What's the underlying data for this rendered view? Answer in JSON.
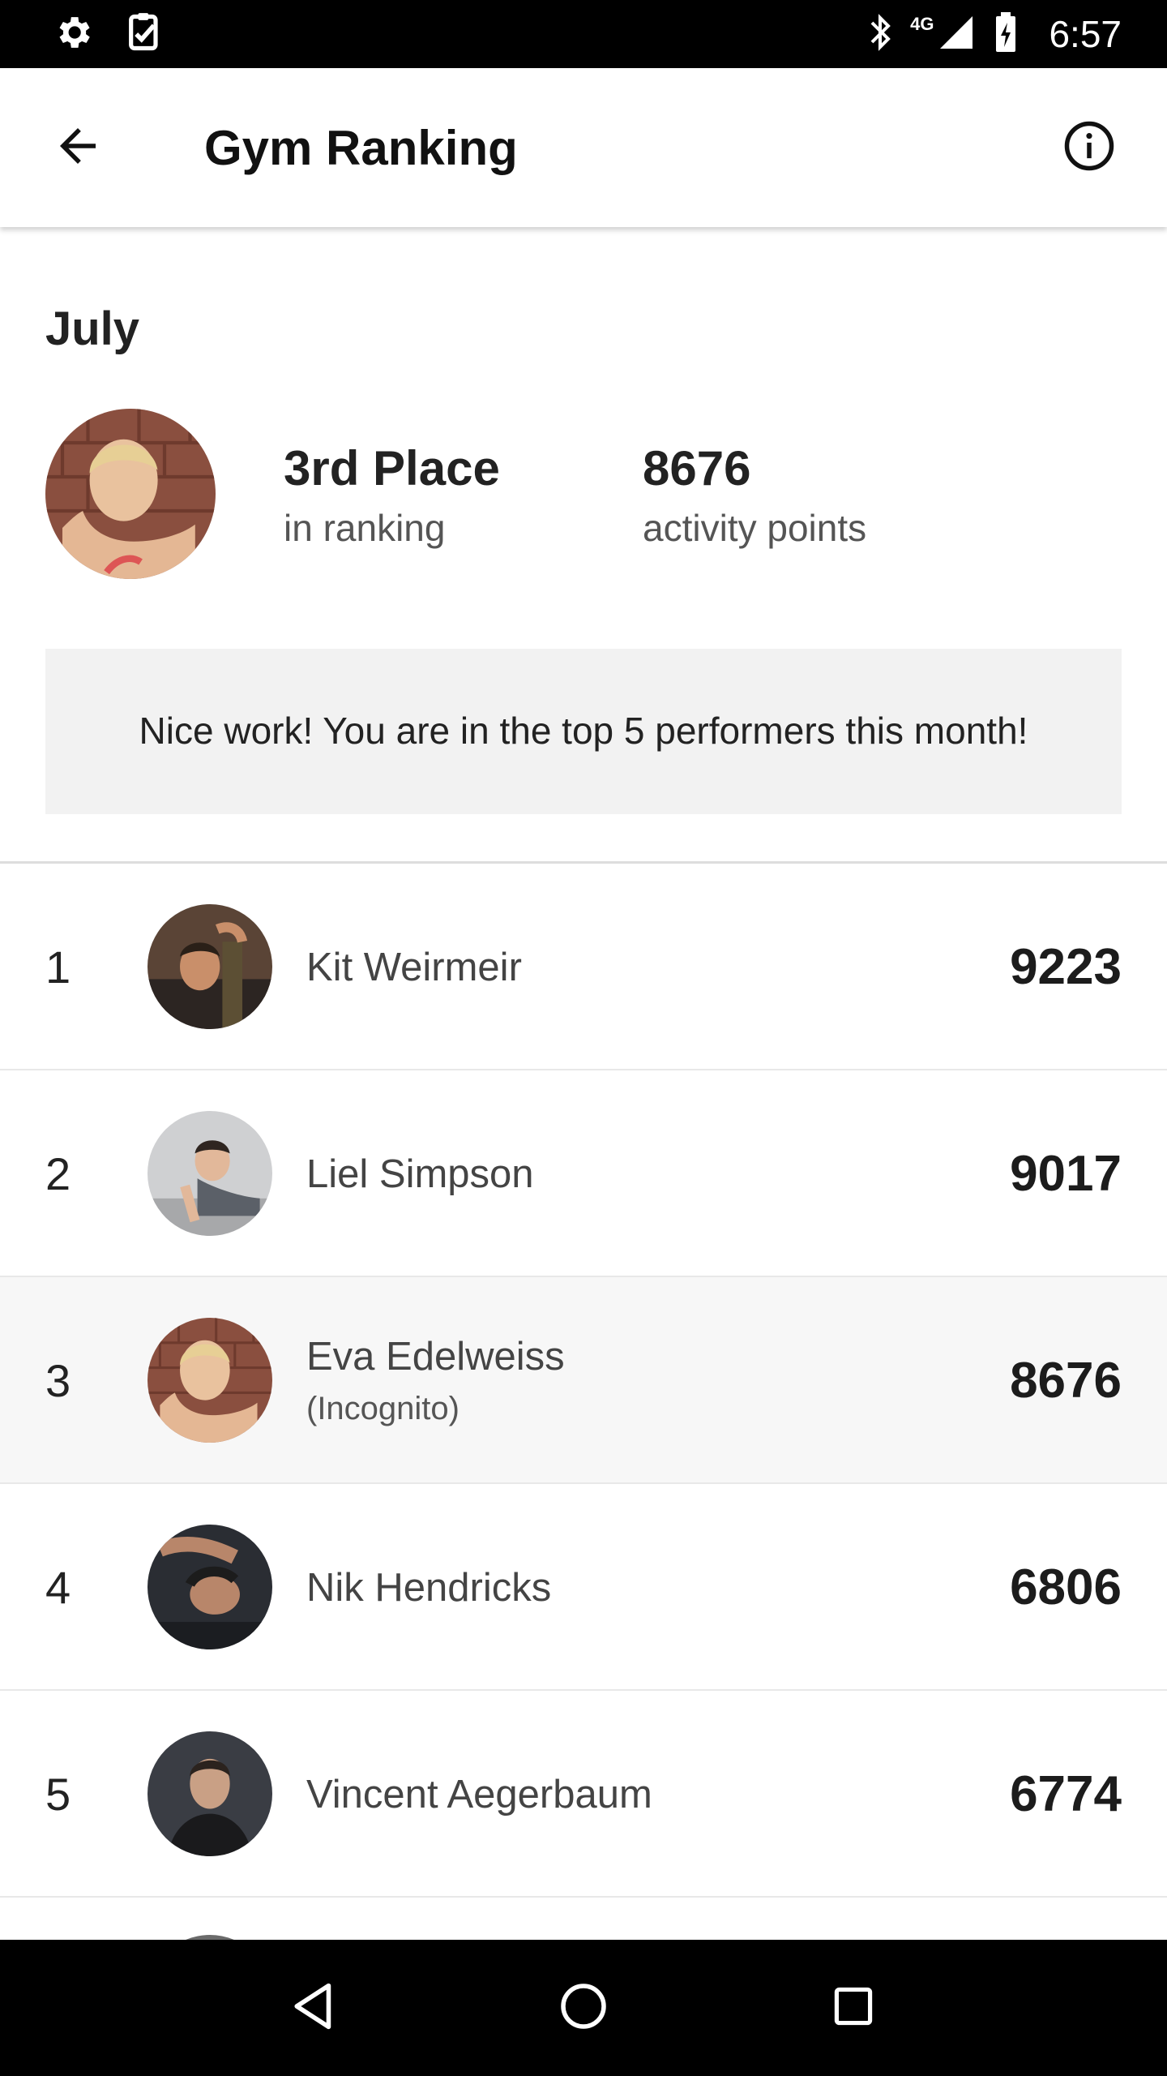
{
  "status_bar": {
    "time": "6:57",
    "network_type": "4G",
    "icons": [
      "settings-icon",
      "task-check-icon",
      "bluetooth-icon",
      "signal-icon",
      "battery-charging-icon"
    ]
  },
  "app_bar": {
    "title": "Gym Ranking",
    "back_icon": "arrow-back-icon",
    "info_icon": "info-icon"
  },
  "summary": {
    "month": "July",
    "place_value": "3rd Place",
    "place_label": "in ranking",
    "points_value": "8676",
    "points_label": "activity points",
    "banner_text": "Nice work! You are in the top 5 performers this month!"
  },
  "ranking": [
    {
      "rank": "1",
      "name": "Kit Weirmeir",
      "sub": "",
      "points": "9223"
    },
    {
      "rank": "2",
      "name": "Liel Simpson",
      "sub": "",
      "points": "9017"
    },
    {
      "rank": "3",
      "name": "Eva Edelweiss",
      "sub": "(Incognito)",
      "points": "8676"
    },
    {
      "rank": "4",
      "name": "Nik Hendricks",
      "sub": "",
      "points": "6806"
    },
    {
      "rank": "5",
      "name": "Vincent Aegerbaum",
      "sub": "",
      "points": "6774"
    }
  ],
  "nav_bar": {
    "icons": [
      "nav-back-icon",
      "nav-home-icon",
      "nav-recents-icon"
    ]
  },
  "colors": {
    "status_bar_bg": "#000000",
    "banner_bg": "#f2f2f2",
    "highlight_row_bg": "#f7f7f7",
    "nav_bar_bg": "#000000"
  }
}
